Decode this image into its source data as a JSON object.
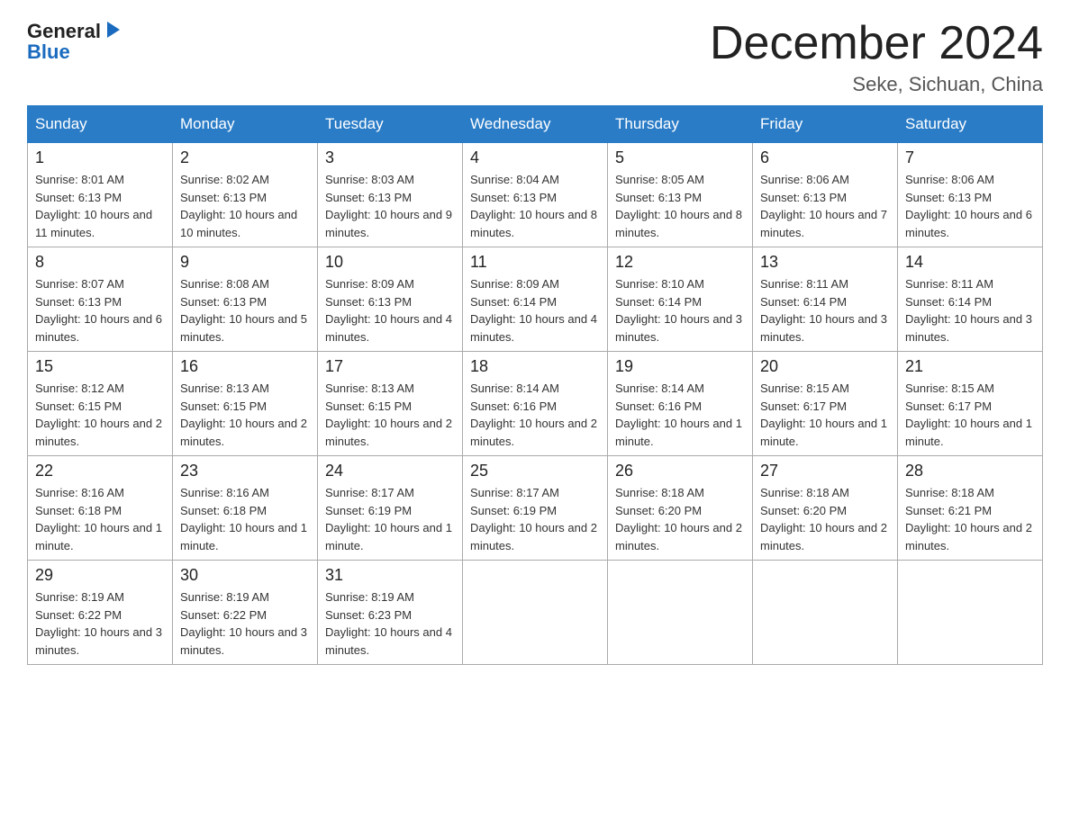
{
  "logo": {
    "general": "General",
    "blue": "Blue"
  },
  "title": "December 2024",
  "subtitle": "Seke, Sichuan, China",
  "weekdays": [
    "Sunday",
    "Monday",
    "Tuesday",
    "Wednesday",
    "Thursday",
    "Friday",
    "Saturday"
  ],
  "weeks": [
    [
      {
        "day": "1",
        "sunrise": "8:01 AM",
        "sunset": "6:13 PM",
        "daylight": "10 hours and 11 minutes."
      },
      {
        "day": "2",
        "sunrise": "8:02 AM",
        "sunset": "6:13 PM",
        "daylight": "10 hours and 10 minutes."
      },
      {
        "day": "3",
        "sunrise": "8:03 AM",
        "sunset": "6:13 PM",
        "daylight": "10 hours and 9 minutes."
      },
      {
        "day": "4",
        "sunrise": "8:04 AM",
        "sunset": "6:13 PM",
        "daylight": "10 hours and 8 minutes."
      },
      {
        "day": "5",
        "sunrise": "8:05 AM",
        "sunset": "6:13 PM",
        "daylight": "10 hours and 8 minutes."
      },
      {
        "day": "6",
        "sunrise": "8:06 AM",
        "sunset": "6:13 PM",
        "daylight": "10 hours and 7 minutes."
      },
      {
        "day": "7",
        "sunrise": "8:06 AM",
        "sunset": "6:13 PM",
        "daylight": "10 hours and 6 minutes."
      }
    ],
    [
      {
        "day": "8",
        "sunrise": "8:07 AM",
        "sunset": "6:13 PM",
        "daylight": "10 hours and 6 minutes."
      },
      {
        "day": "9",
        "sunrise": "8:08 AM",
        "sunset": "6:13 PM",
        "daylight": "10 hours and 5 minutes."
      },
      {
        "day": "10",
        "sunrise": "8:09 AM",
        "sunset": "6:13 PM",
        "daylight": "10 hours and 4 minutes."
      },
      {
        "day": "11",
        "sunrise": "8:09 AM",
        "sunset": "6:14 PM",
        "daylight": "10 hours and 4 minutes."
      },
      {
        "day": "12",
        "sunrise": "8:10 AM",
        "sunset": "6:14 PM",
        "daylight": "10 hours and 3 minutes."
      },
      {
        "day": "13",
        "sunrise": "8:11 AM",
        "sunset": "6:14 PM",
        "daylight": "10 hours and 3 minutes."
      },
      {
        "day": "14",
        "sunrise": "8:11 AM",
        "sunset": "6:14 PM",
        "daylight": "10 hours and 3 minutes."
      }
    ],
    [
      {
        "day": "15",
        "sunrise": "8:12 AM",
        "sunset": "6:15 PM",
        "daylight": "10 hours and 2 minutes."
      },
      {
        "day": "16",
        "sunrise": "8:13 AM",
        "sunset": "6:15 PM",
        "daylight": "10 hours and 2 minutes."
      },
      {
        "day": "17",
        "sunrise": "8:13 AM",
        "sunset": "6:15 PM",
        "daylight": "10 hours and 2 minutes."
      },
      {
        "day": "18",
        "sunrise": "8:14 AM",
        "sunset": "6:16 PM",
        "daylight": "10 hours and 2 minutes."
      },
      {
        "day": "19",
        "sunrise": "8:14 AM",
        "sunset": "6:16 PM",
        "daylight": "10 hours and 1 minute."
      },
      {
        "day": "20",
        "sunrise": "8:15 AM",
        "sunset": "6:17 PM",
        "daylight": "10 hours and 1 minute."
      },
      {
        "day": "21",
        "sunrise": "8:15 AM",
        "sunset": "6:17 PM",
        "daylight": "10 hours and 1 minute."
      }
    ],
    [
      {
        "day": "22",
        "sunrise": "8:16 AM",
        "sunset": "6:18 PM",
        "daylight": "10 hours and 1 minute."
      },
      {
        "day": "23",
        "sunrise": "8:16 AM",
        "sunset": "6:18 PM",
        "daylight": "10 hours and 1 minute."
      },
      {
        "day": "24",
        "sunrise": "8:17 AM",
        "sunset": "6:19 PM",
        "daylight": "10 hours and 1 minute."
      },
      {
        "day": "25",
        "sunrise": "8:17 AM",
        "sunset": "6:19 PM",
        "daylight": "10 hours and 2 minutes."
      },
      {
        "day": "26",
        "sunrise": "8:18 AM",
        "sunset": "6:20 PM",
        "daylight": "10 hours and 2 minutes."
      },
      {
        "day": "27",
        "sunrise": "8:18 AM",
        "sunset": "6:20 PM",
        "daylight": "10 hours and 2 minutes."
      },
      {
        "day": "28",
        "sunrise": "8:18 AM",
        "sunset": "6:21 PM",
        "daylight": "10 hours and 2 minutes."
      }
    ],
    [
      {
        "day": "29",
        "sunrise": "8:19 AM",
        "sunset": "6:22 PM",
        "daylight": "10 hours and 3 minutes."
      },
      {
        "day": "30",
        "sunrise": "8:19 AM",
        "sunset": "6:22 PM",
        "daylight": "10 hours and 3 minutes."
      },
      {
        "day": "31",
        "sunrise": "8:19 AM",
        "sunset": "6:23 PM",
        "daylight": "10 hours and 4 minutes."
      },
      null,
      null,
      null,
      null
    ]
  ]
}
